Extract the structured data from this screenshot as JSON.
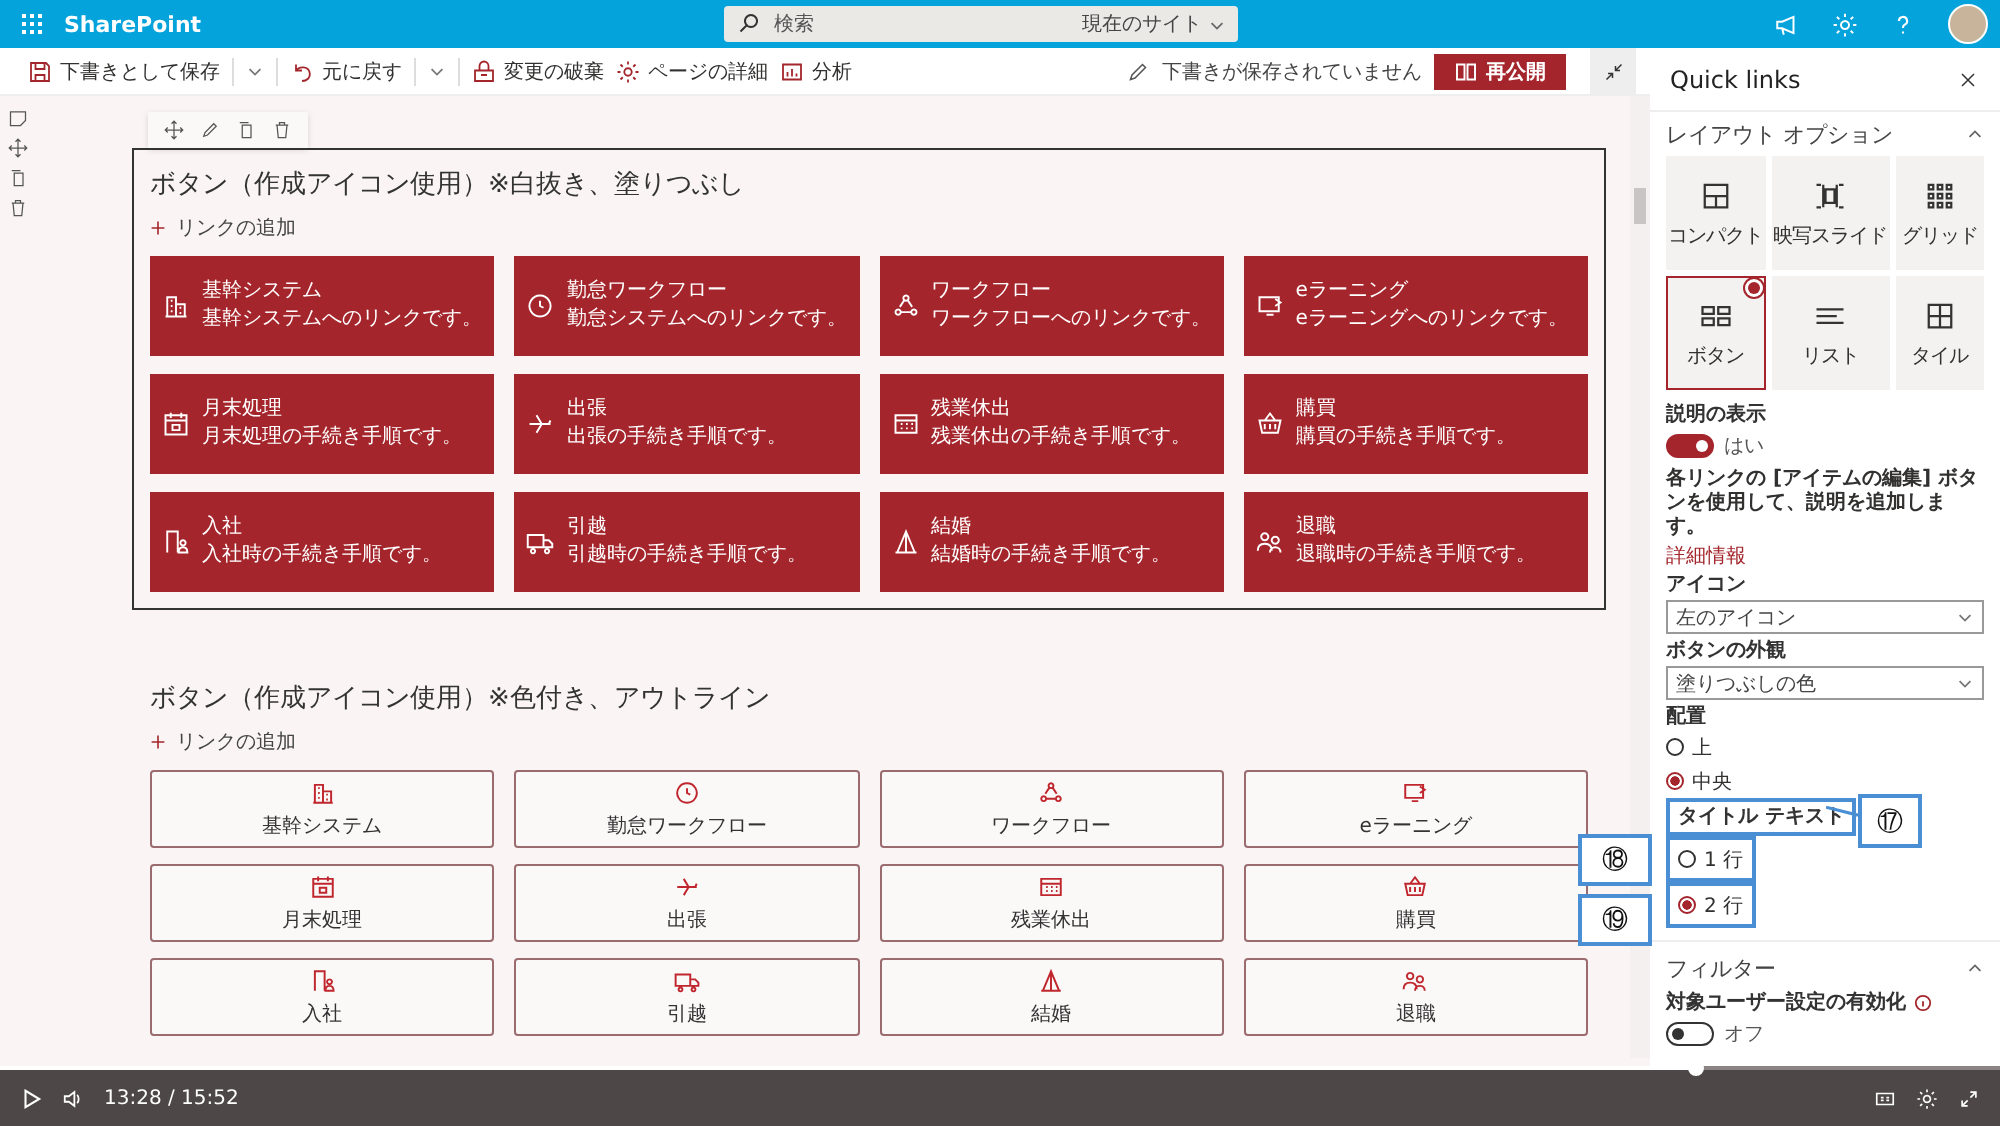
{
  "topbar": {
    "app_name": "SharePoint",
    "search": {
      "placeholder": "検索",
      "scope": "現在のサイト"
    }
  },
  "toolbar": {
    "actions": [
      {
        "label": "下書きとして保存",
        "menu": true
      },
      {
        "label": "元に戻す",
        "menu": true
      },
      {
        "label": "変更の破棄",
        "menu": false
      },
      {
        "label": "ページの詳細",
        "menu": false
      },
      {
        "label": "分析",
        "menu": false
      }
    ],
    "status": "下書きが保存されていません",
    "publish": "再公開"
  },
  "sections": [
    {
      "title": "ボタン（作成アイコン使用）※白抜き、塗りつぶし",
      "add_link": "リンクの追加",
      "kind": "filled",
      "selected": true,
      "links": [
        {
          "title": "基幹システム",
          "description": "基幹システムへのリンクです。"
        },
        {
          "title": "勤怠ワークフロー",
          "description": "勤怠システムへのリンクです。"
        },
        {
          "title": "ワークフロー",
          "description": "ワークフローへのリンクです。"
        },
        {
          "title": "eラーニング",
          "description": "eラーニングへのリンクです。"
        },
        {
          "title": "月末処理",
          "description": "月末処理の手続き手順です。"
        },
        {
          "title": "出張",
          "description": "出張の手続き手順です。"
        },
        {
          "title": "残業休出",
          "description": "残業休出の手続き手順です。"
        },
        {
          "title": "購買",
          "description": "購買の手続き手順です。"
        },
        {
          "title": "入社",
          "description": "入社時の手続き手順です。"
        },
        {
          "title": "引越",
          "description": "引越時の手続き手順です。"
        },
        {
          "title": "結婚",
          "description": "結婚時の手続き手順です。"
        },
        {
          "title": "退職",
          "description": "退職時の手続き手順です。"
        }
      ]
    },
    {
      "title": "ボタン（作成アイコン使用）※色付き、アウトライン",
      "add_link": "リンクの追加",
      "kind": "outline",
      "selected": false,
      "links": [
        {
          "title": "基幹システム"
        },
        {
          "title": "勤怠ワークフロー"
        },
        {
          "title": "ワークフロー"
        },
        {
          "title": "eラーニング"
        },
        {
          "title": "月末処理"
        },
        {
          "title": "出張"
        },
        {
          "title": "残業休出"
        },
        {
          "title": "購買"
        },
        {
          "title": "入社"
        },
        {
          "title": "引越"
        },
        {
          "title": "結婚"
        },
        {
          "title": "退職"
        }
      ]
    }
  ],
  "panel": {
    "title": "Quick links",
    "layout": {
      "heading": "レイアウト オプション",
      "expanded": true,
      "options": [
        {
          "label": "コンパクト",
          "selected": false
        },
        {
          "label": "映写スライド",
          "selected": false
        },
        {
          "label": "グリッド",
          "selected": false
        },
        {
          "label": "ボタン",
          "selected": true
        },
        {
          "label": "リスト",
          "selected": false
        },
        {
          "label": "タイル",
          "selected": false
        }
      ]
    },
    "show_description": {
      "label": "説明の表示",
      "on": true,
      "state_label": "はい"
    },
    "help_text": "各リンクの [アイテムの編集] ボタンを使用して、説明を追加します。",
    "help_link": "詳細情報",
    "icon": {
      "label": "アイコン",
      "value": "左のアイコン"
    },
    "appearance": {
      "label": "ボタンの外観",
      "value": "塗りつぶしの色"
    },
    "alignment": {
      "label": "配置",
      "options": [
        {
          "label": "上",
          "selected": false
        },
        {
          "label": "中央",
          "selected": true
        }
      ]
    },
    "title_text": {
      "label": "タイトル テキスト",
      "options": [
        {
          "label": "1 行",
          "selected": false
        },
        {
          "label": "2 行",
          "selected": true
        }
      ]
    },
    "filter": {
      "heading": "フィルター",
      "expanded": true,
      "audience": {
        "label": "対象ユーザー設定の有効化",
        "on": false,
        "state_label": "オフ"
      }
    }
  },
  "callouts": [
    {
      "number": "⑰"
    },
    {
      "number": "⑱"
    },
    {
      "number": "⑲"
    }
  ],
  "video": {
    "time": "13:28 / 15:52",
    "level": 0.848
  }
}
